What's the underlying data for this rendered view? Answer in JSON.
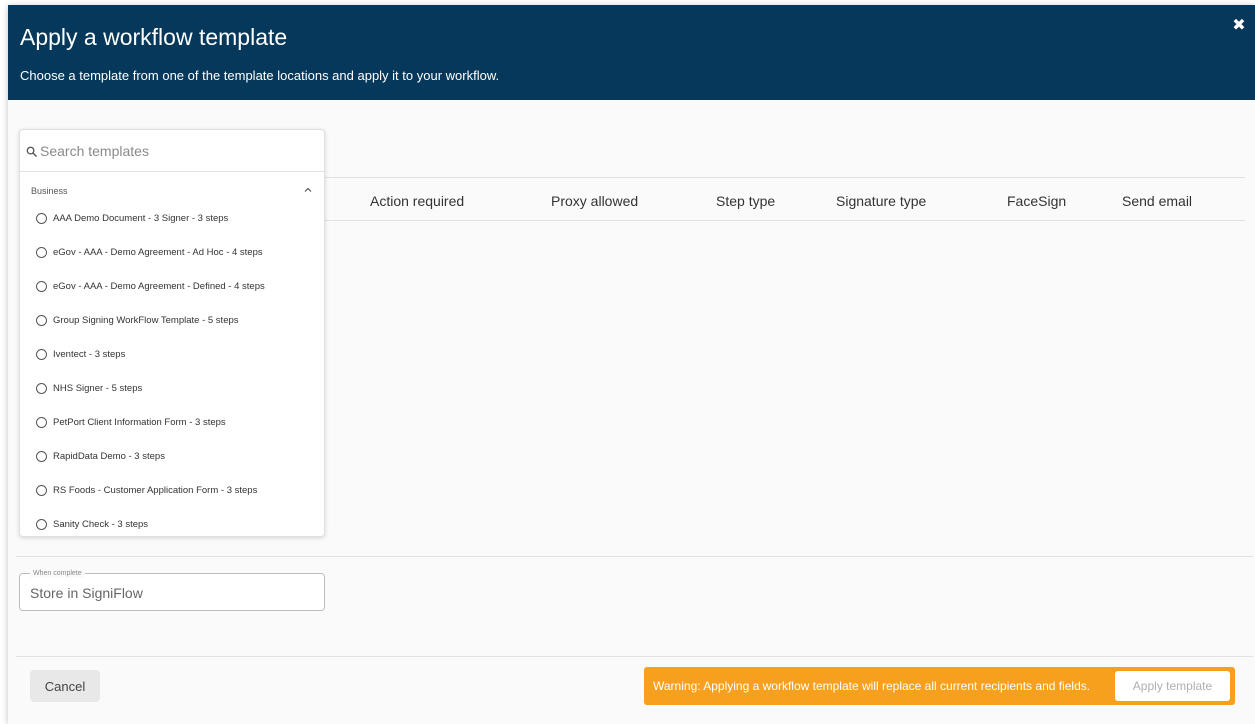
{
  "dialog": {
    "title": "Apply a workflow template",
    "subtitle": "Choose a template from one of the template locations and apply it to your workflow.",
    "close_icon": "close-icon"
  },
  "search": {
    "placeholder": "Search templates",
    "icon": "search-icon"
  },
  "template_group": {
    "label": "Business",
    "chevron_icon": "chevron-up-icon",
    "items": [
      {
        "label": "AAA Demo Document - 3 Signer - 3 steps"
      },
      {
        "label": "eGov - AAA - Demo Agreement - Ad Hoc - 4 steps"
      },
      {
        "label": "eGov - AAA - Demo Agreement - Defined - 4 steps"
      },
      {
        "label": "Group Signing WorkFlow Template - 5 steps"
      },
      {
        "label": "Iventect - 3 steps"
      },
      {
        "label": "NHS Signer - 5 steps"
      },
      {
        "label": "PetPort Client Information Form - 3 steps"
      },
      {
        "label": "RapidData Demo - 3 steps"
      },
      {
        "label": "RS Foods - Customer Application Form - 3 steps"
      },
      {
        "label": "Sanity Check - 3 steps"
      }
    ]
  },
  "table": {
    "columns": [
      "Action required",
      "Proxy allowed",
      "Step type",
      "Signature type",
      "FaceSign",
      "Send email"
    ]
  },
  "when_complete": {
    "legend": "When complete",
    "value": "Store in SigniFlow"
  },
  "footer": {
    "cancel_label": "Cancel",
    "warning_text": "Warning: Applying a workflow template will replace all current recipients and fields.",
    "apply_label": "Apply template",
    "warning_color": "#f6a01d",
    "header_color": "#05385a"
  }
}
